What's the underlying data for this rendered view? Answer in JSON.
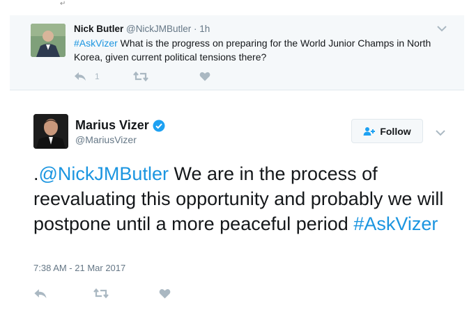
{
  "decor": {
    "return_mark": "↵"
  },
  "parent_tweet": {
    "display_name": "Nick Butler",
    "handle": "@NickJMButler",
    "separator": "·",
    "time": "1h",
    "hashtag": "#AskVizer",
    "text": " What is the progress on preparing for the World Junior Champs in North Korea, given current political tensions there?",
    "reply_count": "1",
    "icons": {
      "reply": "reply-icon",
      "retweet": "retweet-icon",
      "like": "heart-icon",
      "menu": "chevron-down-icon"
    }
  },
  "main_tweet": {
    "display_name": "Marius Vizer",
    "handle": "@MariusVizer",
    "verified": true,
    "follow_label": "Follow",
    "text_prefix": ".",
    "mention": "@NickJMButler",
    "text": " We are in the process of reevaluating this opportunity and probably we will postpone until a more peaceful period ",
    "hashtag": "#AskVizer",
    "timestamp": "7:38 AM - 21 Mar 2017",
    "icons": {
      "verified": "verified-badge-icon",
      "follow": "add-user-icon",
      "reply": "reply-icon",
      "retweet": "retweet-icon",
      "like": "heart-icon",
      "menu": "chevron-down-icon"
    }
  },
  "colors": {
    "link": "#1b95e0",
    "muted": "#657786",
    "icon": "#aab8c2",
    "parent_bg": "#f5f8fa"
  }
}
